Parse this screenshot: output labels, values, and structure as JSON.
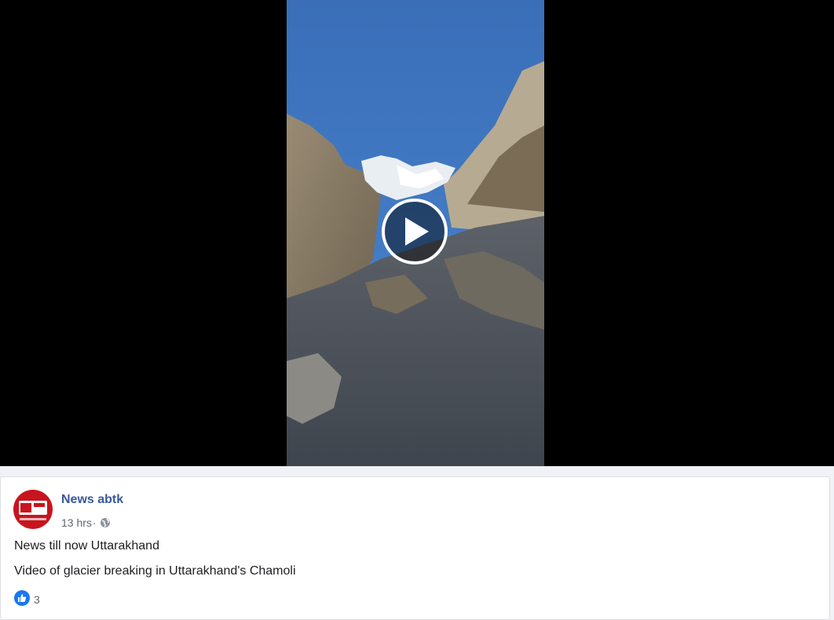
{
  "video": {
    "play_icon": "play-icon"
  },
  "post": {
    "page_name": "News abtk",
    "timestamp": "13 hrs",
    "separator": "·",
    "privacy_icon": "globe-icon",
    "text_line_1": "News till now Uttarakhand",
    "text_line_2": "Video of glacier breaking in Uttarakhand's Chamoli",
    "reaction_icon": "like-icon",
    "reaction_count": "3"
  },
  "colors": {
    "page_name": "#385898",
    "like_blue": "#1877f2",
    "avatar_red": "#c8141e"
  }
}
